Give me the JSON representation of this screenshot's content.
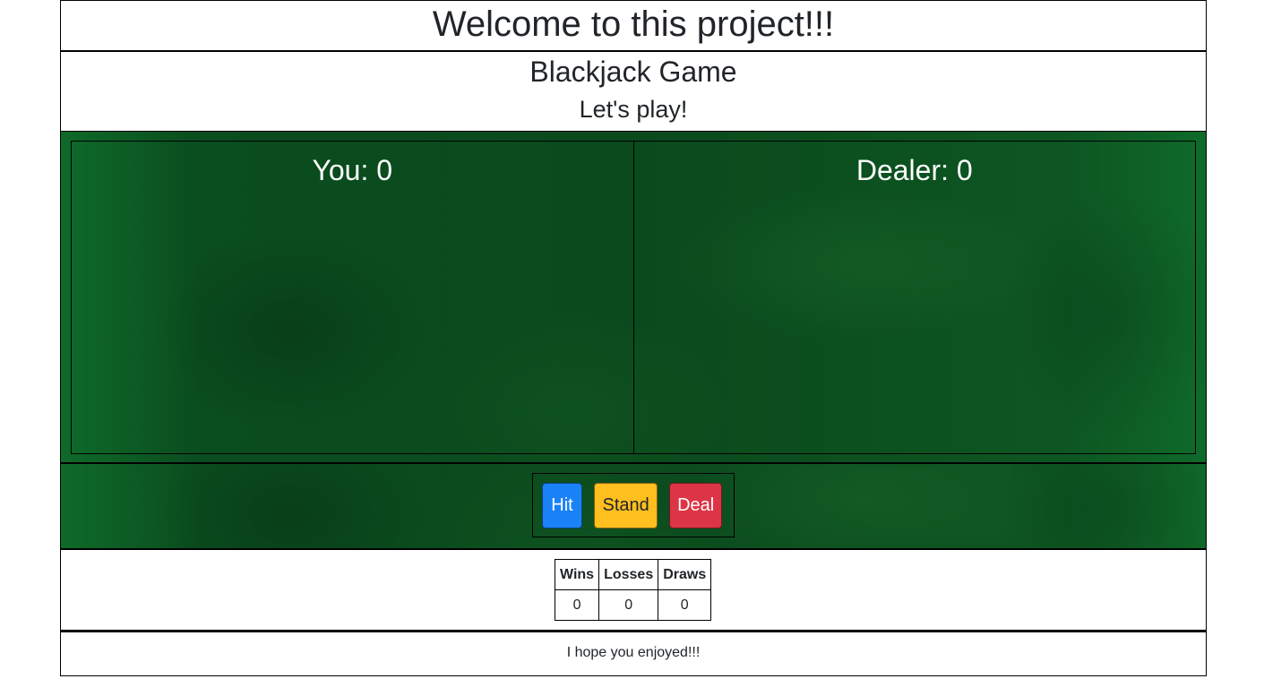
{
  "header": {
    "title": "Welcome to this project!!!"
  },
  "intro": {
    "game_title": "Blackjack Game",
    "subtitle": "Let's play!"
  },
  "board": {
    "player_label": "You: 0",
    "dealer_label": "Dealer: 0"
  },
  "controls": {
    "hit_label": "Hit",
    "stand_label": "Stand",
    "deal_label": "Deal"
  },
  "scoreboard": {
    "headers": [
      "Wins",
      "Losses",
      "Draws"
    ],
    "values": [
      "0",
      "0",
      "0"
    ]
  },
  "footer": {
    "text": "I hope you enjoyed!!!"
  },
  "colors": {
    "hit_button": "#1a82f7",
    "stand_button": "#ffbf1f",
    "deal_button": "#dc3545",
    "felt_green": "#0b4a1f"
  }
}
